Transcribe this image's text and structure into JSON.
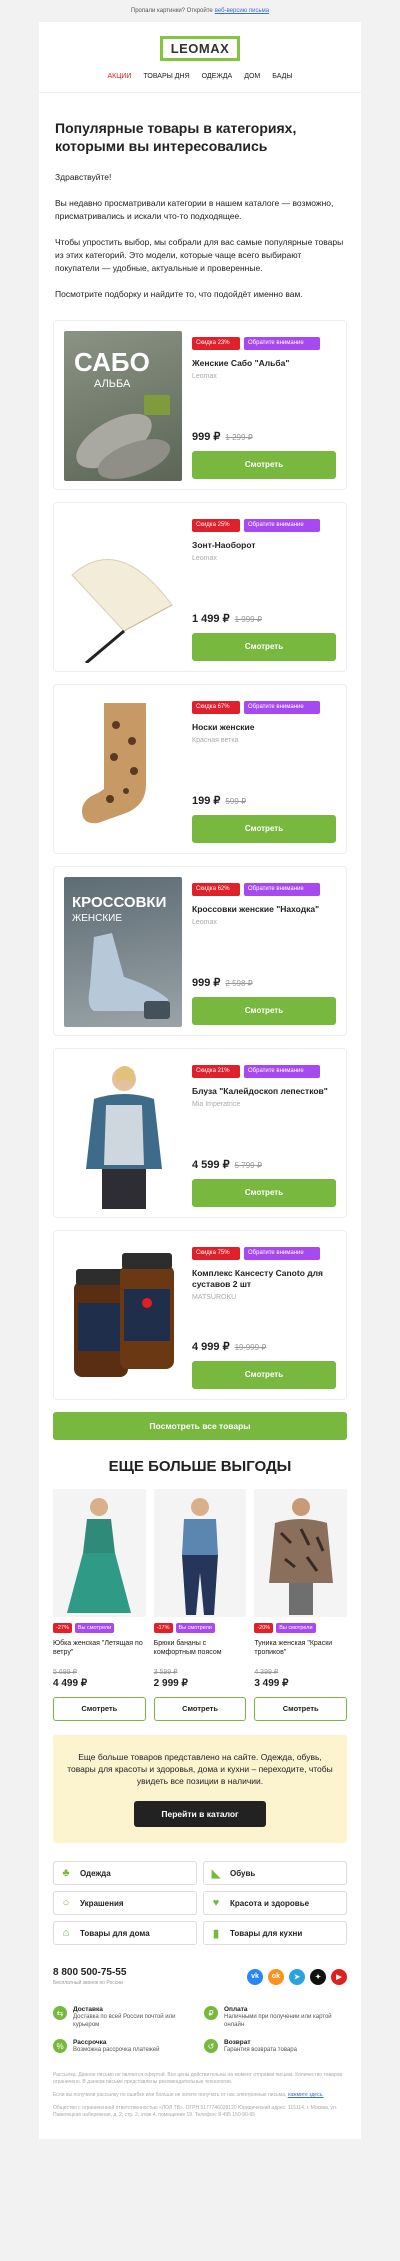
{
  "preheader": {
    "text": "Пропали картинки? Откройте",
    "link": "веб-версию письма"
  },
  "logo": "LEOMAX",
  "nav": [
    "АКЦИИ",
    "ТОВАРЫ ДНЯ",
    "ОДЕЖДА",
    "ДОМ",
    "БАДЫ"
  ],
  "intro": {
    "title": "Популярные товары в категориях, которыми вы интересовались",
    "greeting": "Здравствуйте!",
    "p1": "Вы недавно просматривали категории в нашем каталоге — возможно, присматривались и искали что-то подходящее.",
    "p2": "Чтобы упростить выбор, мы собрали для вас самые популярные товары из этих категорий. Это модели, которые чаще всего выбирают покупатели — удобные, актуальные и проверенные.",
    "p3": "Посмотрите подборку и найдите то, что подойдёт именно вам."
  },
  "products": [
    {
      "discount": "Скидка 23%",
      "attention": "Обратите внимание",
      "name": "Женские Сабо \"Альба\"",
      "brand": "Leomax",
      "price": "999 ₽",
      "old": "1 299 ₽",
      "button": "Смотреть",
      "img_text": "САБО",
      "img_sub": "АЛЬБА"
    },
    {
      "discount": "Скидка 25%",
      "attention": "Обратите внимание",
      "name": "Зонт-Наоборот",
      "brand": "Leomax",
      "price": "1 499 ₽",
      "old": "1 999 ₽",
      "button": "Смотреть",
      "img_text": "",
      "img_sub": ""
    },
    {
      "discount": "Скидка 67%",
      "attention": "Обратите внимание",
      "name": "Носки женские",
      "brand": "Красная ветка",
      "price": "199 ₽",
      "old": "599 ₽",
      "button": "Смотреть",
      "img_text": "",
      "img_sub": ""
    },
    {
      "discount": "Скидка 62%",
      "attention": "Обратите внимание",
      "name": "Кроссовки женские \"Находка\"",
      "brand": "Leomax",
      "price": "999 ₽",
      "old": "2 598 ₽",
      "button": "Смотреть",
      "img_text": "КРОССОВКИ",
      "img_sub": "ЖЕНСКИЕ"
    },
    {
      "discount": "Скидка 21%",
      "attention": "Обратите внимание",
      "name": "Блуза \"Калейдоскоп лепестков\"",
      "brand": "Mia Imperatrice",
      "price": "4 599 ₽",
      "old": "5 799 ₽",
      "button": "Смотреть",
      "img_text": "",
      "img_sub": ""
    },
    {
      "discount": "Скидка 75%",
      "attention": "Обратите внимание",
      "name": "Комплекс Кансесту Canoto для суставов 2 шт",
      "brand": "MATSUROKU",
      "price": "4 999 ₽",
      "old": "19 999 ₽",
      "button": "Смотреть",
      "img_text": "",
      "img_sub": ""
    }
  ],
  "all_button": "Посмотреть все товары",
  "more_title": "ЕЩЕ БОЛЬШЕ ВЫГОДЫ",
  "more_items": [
    {
      "discount": "-27%",
      "hit": "Вы смотрели",
      "name": "Юбка женская \"Летящая по ветру\"",
      "old": "5 699 ₽",
      "price": "4 499 ₽",
      "button": "Смотреть"
    },
    {
      "discount": "-17%",
      "hit": "Вы смотрели",
      "name": "Брюки бананы с комфортным поясом",
      "old": "3 599 ₽",
      "price": "2 999 ₽",
      "button": "Смотреть"
    },
    {
      "discount": "-20%",
      "hit": "Вы смотрели",
      "name": "Туника женская \"Краски тропиков\"",
      "old": "4 399 ₽",
      "price": "3 499 ₽",
      "button": "Смотреть"
    }
  ],
  "promo": {
    "text": "Еще больше товаров представлено на сайте. Одежда, обувь, товары для красоты и здоровья, дома и кухни – переходите, чтобы увидеть все позиции в наличии.",
    "button": "Перейти в каталог"
  },
  "categories": [
    {
      "label": "Одежда",
      "icon": "shirt-icon",
      "glyph": "♣"
    },
    {
      "label": "Обувь",
      "icon": "shoe-icon",
      "glyph": "◣"
    },
    {
      "label": "Украшения",
      "icon": "ring-icon",
      "glyph": "○"
    },
    {
      "label": "Красота и здоровье",
      "icon": "heart-icon",
      "glyph": "♥"
    },
    {
      "label": "Товары для дома",
      "icon": "home-icon",
      "glyph": "⌂"
    },
    {
      "label": "Товары для кухни",
      "icon": "cup-icon",
      "glyph": "▮"
    }
  ],
  "footer": {
    "phone": "8 800 500-75-55",
    "phone_sub": "Бесплатный звонок по России",
    "socials": [
      {
        "name": "vk-icon",
        "glyph": "vk",
        "color": "#2787f5"
      },
      {
        "name": "ok-icon",
        "glyph": "ok",
        "color": "#f7931e"
      },
      {
        "name": "telegram-icon",
        "glyph": "➤",
        "color": "#2aa3de"
      },
      {
        "name": "zen-icon",
        "glyph": "✦",
        "color": "#111111"
      },
      {
        "name": "youtube-icon",
        "glyph": "▶",
        "color": "#e02020"
      }
    ],
    "features": [
      {
        "title": "Доставка",
        "desc": "Доставка по всей России почтой или курьером",
        "glyph": "⇆"
      },
      {
        "title": "Оплата",
        "desc": "Наличными при получении или картой онлайн",
        "glyph": "₽"
      },
      {
        "title": "Рассрочка",
        "desc": "Возможна рассрочка платежей",
        "glyph": "%"
      },
      {
        "title": "Возврат",
        "desc": "Гарантия возврата товара",
        "glyph": "↺"
      }
    ],
    "legal1": "Рассылка. Данное письмо не является офертой. Все цены действительны на момент отправки письма. Количество товаров ограничено. В данном письме представлены рекомендательные технологии.",
    "legal2": "Если вы получили рассылку по ошибке или больше не хотите получать от нас электронные письма,",
    "unsubscribe": "нажмите здесь.",
    "legal3": "Общество с ограниченной ответственностью «ЛОЛ ТВ». ОГРН 5177746028120 Юридический адрес: 115114, г. Москва, ул. Павелецкая набережная, д. 2, стр. 2, этаж 4, помещение 19. Телефон: 8 495 150-90-65"
  },
  "colors": {
    "accent": "#78b83e",
    "sale": "#e0202a",
    "attention": "#a848f0",
    "promo_bg": "#fcf4cf"
  }
}
